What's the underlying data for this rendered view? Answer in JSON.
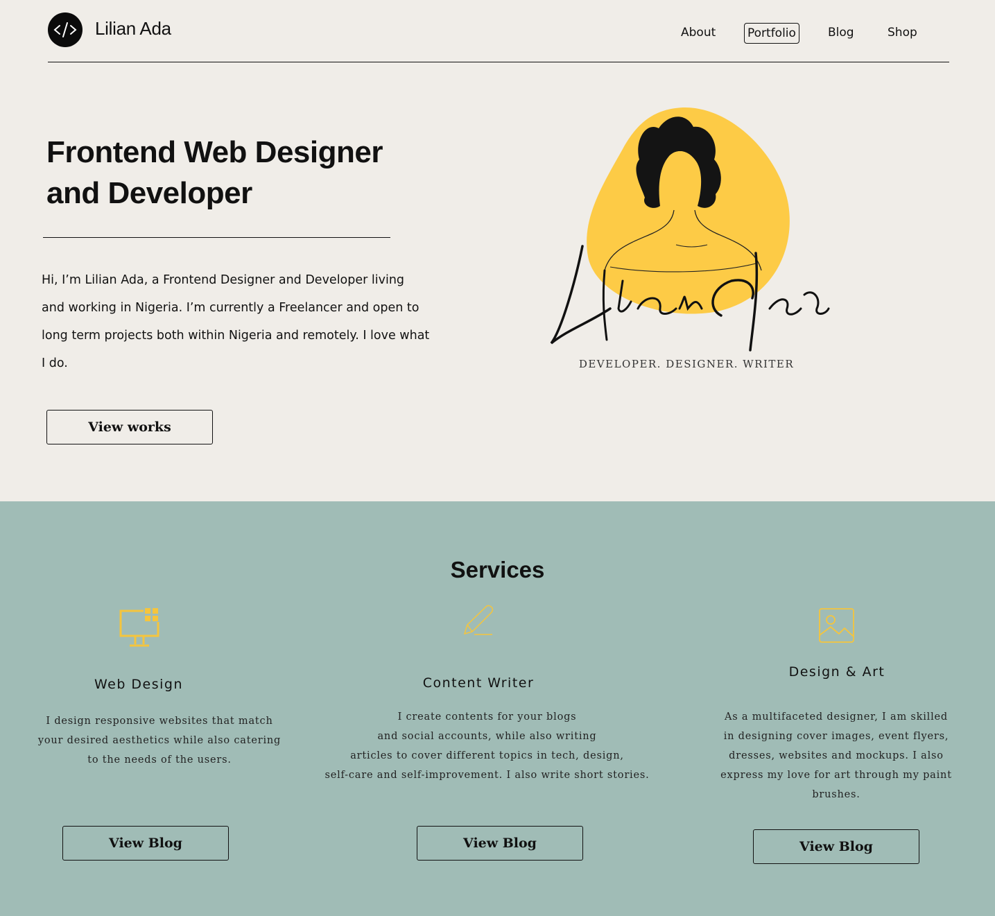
{
  "header": {
    "brand": "Lilian Ada",
    "nav": [
      {
        "label": "About"
      },
      {
        "label": "Portfolio"
      },
      {
        "label": "Blog"
      },
      {
        "label": "Shop"
      }
    ]
  },
  "hero": {
    "title_line1": "Frontend Web Designer",
    "title_line2": "and Developer",
    "intro": "Hi, I’m Lilian Ada, a Frontend Designer and Developer living and working in Nigeria. I’m currently a Freelancer and open to long term projects both within Nigeria and remotely. I love what I do.",
    "cta_label": "View works",
    "illustration_signature": "Lilian Ada",
    "illustration_tagline": "DEVELOPER. DESIGNER. WRITER"
  },
  "services": {
    "title": "Services",
    "items": [
      {
        "icon": "monitor-icon",
        "name": "Web Design",
        "desc_lines": [
          "I design responsive websites that match",
          "your desired aesthetics while also catering",
          "to the needs of the users."
        ],
        "button_label": "View Blog"
      },
      {
        "icon": "pencil-icon",
        "name": "Content Writer",
        "desc_lines": [
          "I create contents for your blogs",
          "and social accounts, while also writing",
          "articles to cover different topics in tech, design,",
          "self-care and self-improvement. I also write short stories."
        ],
        "button_label": "View Blog"
      },
      {
        "icon": "image-icon",
        "name": "Design & Art",
        "desc_lines": [
          "As a multifaceted designer, I am skilled",
          "in designing cover images, event flyers,",
          "dresses, websites and  mockups. I also",
          "express my love for art through my paint",
          "brushes."
        ],
        "button_label": "View Blog"
      }
    ]
  },
  "colors": {
    "background": "#f0ede8",
    "services_bg": "#a0bcb6",
    "accent_yellow": "#fdcb46",
    "text": "#111111"
  }
}
